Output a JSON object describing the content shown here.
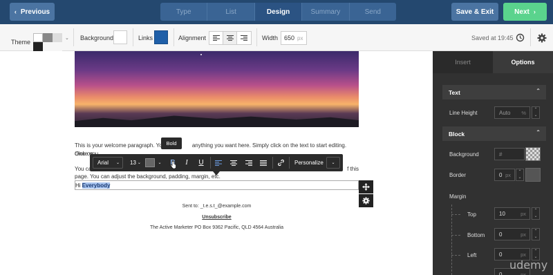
{
  "nav": {
    "prev_label": "Previous",
    "steps": [
      "Type",
      "List",
      "Design",
      "Summary",
      "Send"
    ],
    "active_step": "Design",
    "save_exit_label": "Save & Exit",
    "next_label": "Next"
  },
  "toolbar": {
    "theme_label": "Theme",
    "background_label": "Background",
    "links_label": "Links",
    "links_color": "#1f5fa8",
    "alignment_label": "Alignment",
    "width_label": "Width",
    "width_value": "650",
    "width_unit": "px",
    "saved_text": "Saved at 19:45"
  },
  "content": {
    "para1": "This is your welcome paragraph. You can write anything you want here. Simply click on the text to start editing. Once you click on the text you will have options such as bold, font color, font size, etc.",
    "para1_visible_a": "This is your welcome paragraph. Your",
    "para1_visible_b": "anything you want here. Simply click on the text to start editing. Once you",
    "para1_visible_c": "click on",
    "para2_start": "You ca",
    "para2_end": "f this",
    "para2_line2": "page. You can adjust the background, padding, margin, etc.",
    "hi_prefix": "Hi",
    "hi_selected": "Everybody",
    "sent_to": "Sent to: _t.e.s.t_@example.com",
    "unsubscribe": "Unsubscribe",
    "address": "The Active Marketer PO Box 9362 Pacific, QLD 4564 Australia"
  },
  "format_bar": {
    "tooltip": "Bold",
    "font": "Arial",
    "size": "13",
    "personalize": "Personalize"
  },
  "panel": {
    "tab_insert": "Insert",
    "tab_options": "Options",
    "text_section": "Text",
    "line_height_label": "Line Height",
    "line_height_value": "Auto",
    "line_height_unit": "%",
    "block_section": "Block",
    "background_label": "Background",
    "background_placeholder": "#",
    "border_label": "Border",
    "border_value": "0",
    "border_unit": "px",
    "margin_label": "Margin",
    "top_label": "Top",
    "top_value": "10",
    "bottom_label": "Bottom",
    "bottom_value": "0",
    "left_label": "Left",
    "left_value": "0",
    "right_value": "0",
    "px": "px"
  },
  "watermark": "udemy"
}
